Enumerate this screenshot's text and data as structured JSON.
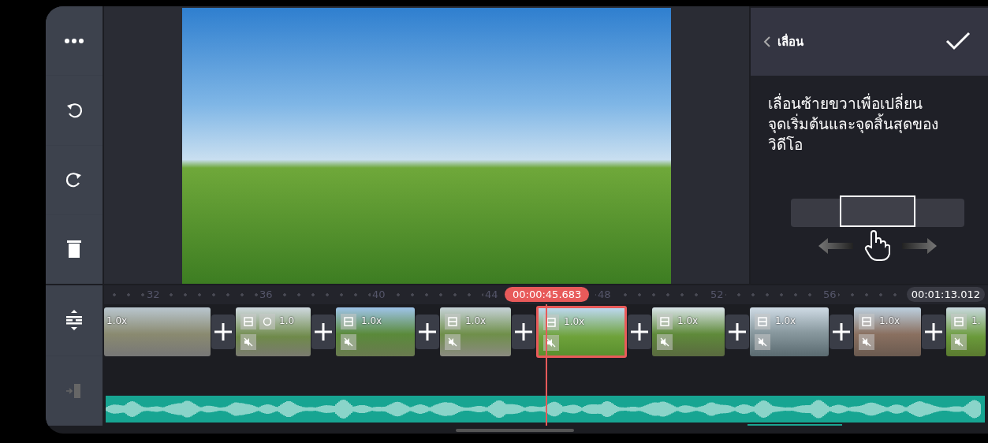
{
  "panel": {
    "title": "เลื่อน",
    "instruction_lines": [
      "เลื่อนซ้ายขวาเพื่อเปลี่ยน",
      "จุดเริ่มต้นและจุดสิ้นสุดของ",
      "วิดีโอ"
    ]
  },
  "timeline": {
    "ruler": [
      "32",
      "36",
      "40",
      "44",
      "48",
      "52",
      "56"
    ],
    "playhead_time": "00:00:45.683",
    "end_time": "00:01:13.012",
    "clips": [
      {
        "speed": "1.0x",
        "selected": false
      },
      {
        "speed": "1.0",
        "selected": false
      },
      {
        "speed": "1.0x",
        "selected": false
      },
      {
        "speed": "1.0x",
        "selected": false
      },
      {
        "speed": "1.0x",
        "selected": true
      },
      {
        "speed": "1.0x",
        "selected": false
      },
      {
        "speed": "1.0x",
        "selected": false
      },
      {
        "speed": "1.0x",
        "selected": false
      },
      {
        "speed": "1.",
        "selected": false
      }
    ]
  }
}
